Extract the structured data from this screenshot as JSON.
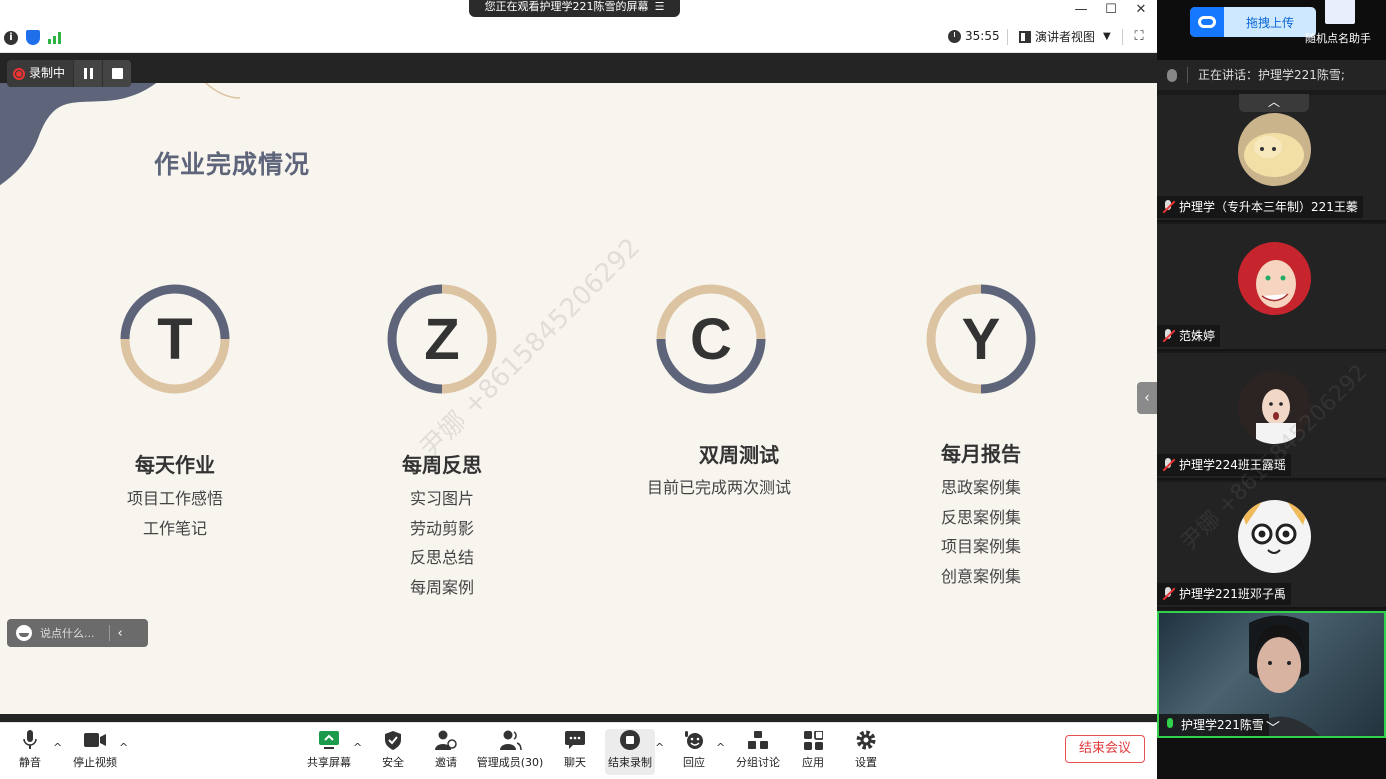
{
  "title_bar": {
    "share_banner": "您正在观看护理学221陈雪的屏幕",
    "minimize": "—",
    "maximize": "☐",
    "close": "✕"
  },
  "info_bar": {
    "timer": "35:55",
    "view_label": "演讲者视图",
    "view_caret": "▼",
    "fullscreen": "⛶"
  },
  "recording": {
    "label": "录制中"
  },
  "slide": {
    "title": "作业完成情况",
    "cards": [
      {
        "letter": "T",
        "title": "每天作业",
        "items": [
          "项目工作感悟",
          "工作笔记"
        ]
      },
      {
        "letter": "Z",
        "title": "每周反思",
        "items": [
          "实习图片",
          "劳动剪影",
          "反思总结",
          "每周案例"
        ]
      },
      {
        "letter": "C",
        "title": "双周测试",
        "items": [
          "目前已完成两次测试"
        ]
      },
      {
        "letter": "Y",
        "title": "每月报告",
        "items": [
          "思政案例集",
          "反思案例集",
          "项目案例集",
          "创意案例集"
        ]
      }
    ],
    "colors": {
      "navy": "#5e6479",
      "tan": "#dcc3a1",
      "bg": "#f8f5ef"
    }
  },
  "watermark": {
    "main": "尹娜 +8615845206292",
    "side": "尹娜 +8615845206292"
  },
  "chat_input": {
    "placeholder": "说点什么...",
    "collapse": "‹"
  },
  "toolbar": {
    "mute": "静音",
    "stop_video": "停止视频",
    "share_screen": "共享屏幕",
    "security": "安全",
    "invite": "邀请",
    "participants": "管理成员(30)",
    "chat": "聊天",
    "end_recording": "结束录制",
    "reactions": "回应",
    "breakout": "分组讨论",
    "apps": "应用",
    "settings": "设置",
    "end_meeting": "结束会议",
    "caret": "^"
  },
  "side_panel": {
    "upload_label": "拖拽上传",
    "assistant_label": "随机点名助手",
    "speaking": "正在讲话：护理学221陈雪;",
    "expand": "‹",
    "collapse": "︿",
    "collapse_down": "﹀",
    "participants": [
      {
        "name": "护理学（专升本三年制）221王蓁"
      },
      {
        "name": "范姝婷"
      },
      {
        "name": "护理学224班王露瑶"
      },
      {
        "name": "护理学221班邓子禹"
      },
      {
        "name": "护理学221陈雪"
      }
    ]
  }
}
